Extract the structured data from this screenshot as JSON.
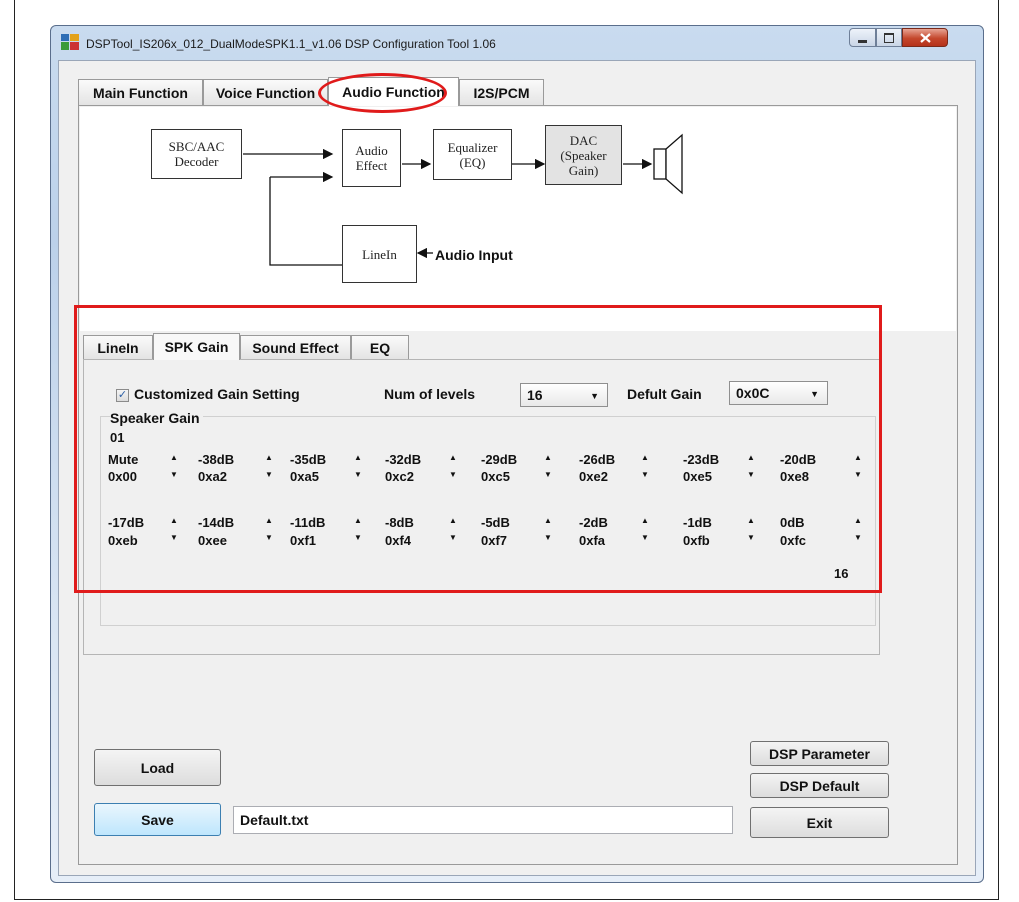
{
  "window": {
    "title": "DSPTool_IS206x_012_DualModeSPK1.1_v1.06 DSP Configuration Tool 1.06"
  },
  "main_tabs": [
    {
      "label": "Main Function"
    },
    {
      "label": "Voice Function"
    },
    {
      "label": "Audio Function",
      "selected": true
    },
    {
      "label": "I2S/PCM"
    }
  ],
  "diagram": {
    "decoder": "SBC/AAC\nDecoder",
    "audio_effect": "Audio\nEffect",
    "equalizer": "Equalizer\n(EQ)",
    "dac": "DAC\n(Speaker\nGain)",
    "linein": "LineIn",
    "audio_input": "Audio Input"
  },
  "sub_tabs": [
    {
      "label": "LineIn"
    },
    {
      "label": "SPK Gain",
      "selected": true
    },
    {
      "label": "Sound Effect"
    },
    {
      "label": "EQ"
    }
  ],
  "spk_gain": {
    "customized_label": "Customized Gain Setting",
    "customized_checked": true,
    "check_glyph": "✓",
    "num_levels_label": "Num of levels",
    "num_levels_value": "16",
    "default_gain_label": "Defult Gain",
    "default_gain_value": "0x0C",
    "group_label": "Speaker Gain",
    "range_start": "01",
    "range_end": "16",
    "row1": [
      {
        "db": "Mute",
        "hex": "0x00"
      },
      {
        "db": "-38dB",
        "hex": "0xa2"
      },
      {
        "db": "-35dB",
        "hex": "0xa5"
      },
      {
        "db": "-32dB",
        "hex": "0xc2"
      },
      {
        "db": "-29dB",
        "hex": "0xc5"
      },
      {
        "db": "-26dB",
        "hex": "0xe2"
      },
      {
        "db": "-23dB",
        "hex": "0xe5"
      },
      {
        "db": "-20dB",
        "hex": "0xe8"
      }
    ],
    "row2": [
      {
        "db": "-17dB",
        "hex": "0xeb"
      },
      {
        "db": "-14dB",
        "hex": "0xee"
      },
      {
        "db": "-11dB",
        "hex": "0xf1"
      },
      {
        "db": "-8dB",
        "hex": "0xf4"
      },
      {
        "db": "-5dB",
        "hex": "0xf7"
      },
      {
        "db": "-2dB",
        "hex": "0xfa"
      },
      {
        "db": "-1dB",
        "hex": "0xfb"
      },
      {
        "db": "0dB",
        "hex": "0xfc"
      }
    ]
  },
  "buttons": {
    "load": "Load",
    "save": "Save",
    "dsp_parameter": "DSP Parameter",
    "dsp_default": "DSP Default",
    "exit": "Exit"
  },
  "file": {
    "value": "Default.txt"
  },
  "glyphs": {
    "spin_up": "▲",
    "spin_down": "▼",
    "dropdown": "▼"
  }
}
